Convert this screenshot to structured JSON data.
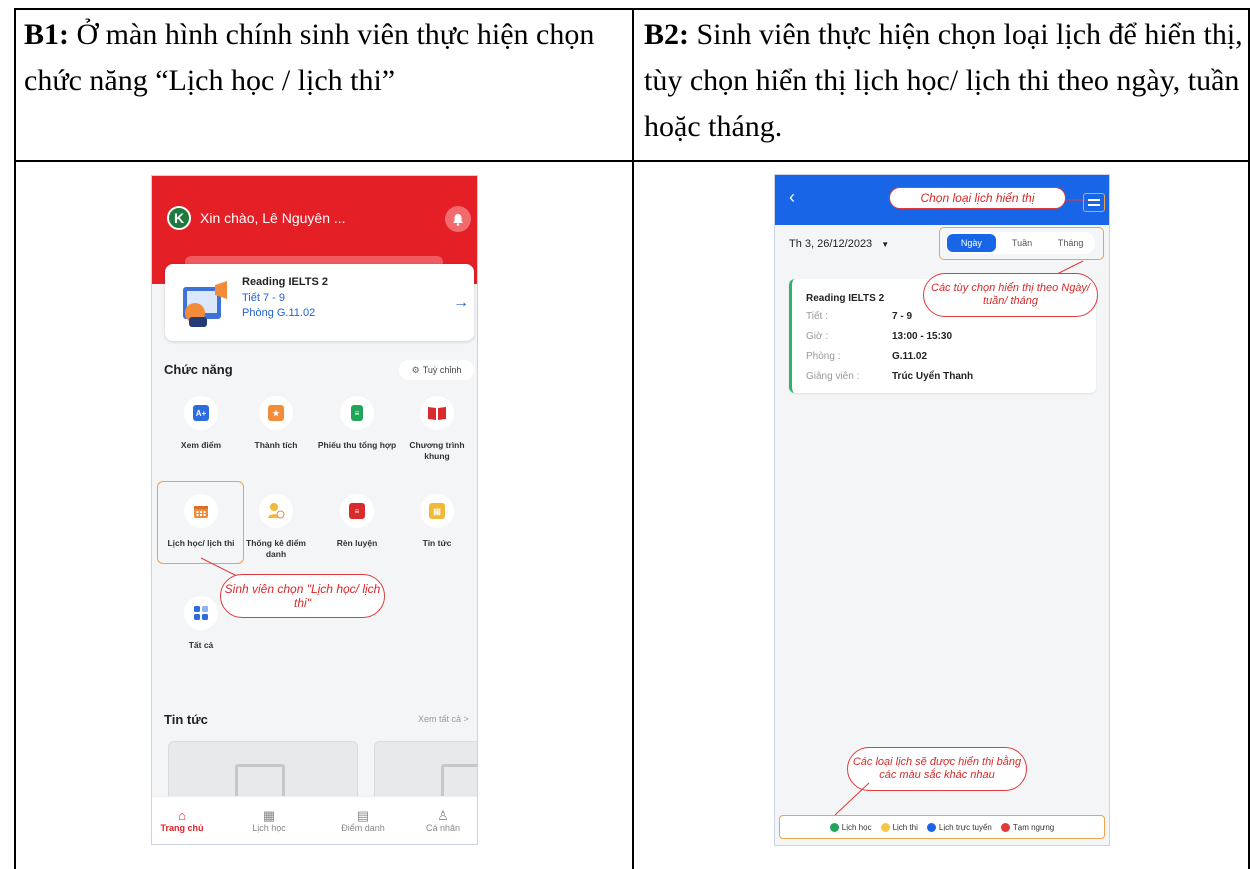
{
  "table": {
    "b1_heading": {
      "label": "B1:",
      "text": " Ở màn hình chính sinh viên thực hiện chọn chức năng “Lịch học / lịch thi”"
    },
    "b2_heading": {
      "label": "B2:",
      "text": " Sinh viên thực hiện chọn loại lịch để hiển thị, tùy chọn hiển thị lịch học/ lịch thi theo ngày, tuần hoặc tháng."
    }
  },
  "phone1": {
    "avatar_letter": "K",
    "greeting": "Xin chào, Lê Nguyên ...",
    "card": {
      "title": "Reading IELTS 2",
      "period": "Tiết 7 - 9",
      "room": "Phòng G.11.02"
    },
    "functions_title": "Chức năng",
    "customize_label": "Tuỳ chỉnh",
    "functions": [
      {
        "label": "Xem điểm",
        "icon": "grade-icon",
        "color": "#2c6be0"
      },
      {
        "label": "Thành tích",
        "icon": "achievement-icon",
        "color": "#f28c38"
      },
      {
        "label": "Phiếu thu tổng hợp",
        "icon": "receipt-icon",
        "color": "#22a55a"
      },
      {
        "label": "Chương trình khung",
        "icon": "book-icon",
        "color": "#d92b2b"
      },
      {
        "label": "Lịch học/ lịch thi",
        "icon": "calendar-icon",
        "color": "#f28c38"
      },
      {
        "label": "Thống kê điểm danh",
        "icon": "attendance-icon",
        "color": "#f2b838"
      },
      {
        "label": "Rèn luyện",
        "icon": "training-icon",
        "color": "#d92b2b"
      },
      {
        "label": "Tin tức",
        "icon": "news-icon",
        "color": "#f2b838"
      },
      {
        "label": "Tất cả",
        "icon": "grid-icon",
        "color": "#2c6be0"
      }
    ],
    "callout": "Sinh viên chọn \"Lịch học/ lịch thi\"",
    "news_title": "Tin tức",
    "news_more": "Xem tất cả >",
    "tabs": [
      {
        "label": "Trang chủ",
        "icon": "home-icon"
      },
      {
        "label": "Lịch học",
        "icon": "calendar-icon"
      },
      {
        "label": "Điểm danh",
        "icon": "checklist-icon"
      },
      {
        "label": "Cá nhân",
        "icon": "person-icon"
      }
    ]
  },
  "phone2": {
    "top_callout": "Chọn loại lịch hiển thị",
    "date": "Th 3, 26/12/2023",
    "segments": [
      "Ngày",
      "Tuần",
      "Tháng"
    ],
    "options_callout": "Các tùy chọn hiển thị theo Ngày/ tuần/ tháng",
    "event": {
      "title": "Reading IELTS 2",
      "rows": [
        {
          "label": "Tiết :",
          "value": "7 - 9"
        },
        {
          "label": "Giờ :",
          "value": "13:00 - 15:30"
        },
        {
          "label": "Phòng :",
          "value": "G.11.02"
        },
        {
          "label": "Giảng viên :",
          "value": "Trúc Uyển Thanh"
        }
      ]
    },
    "legend_callout": "Các loại lịch sẽ được hiển thị bằng các màu sắc khác nhau",
    "legend": [
      {
        "label": "Lịch học",
        "color": "#22a55a"
      },
      {
        "label": "Lịch thi",
        "color": "#f5c44a"
      },
      {
        "label": "Lịch trực tuyến",
        "color": "#1865e8"
      },
      {
        "label": "Tạm ngưng",
        "color": "#e03a3a"
      }
    ]
  }
}
